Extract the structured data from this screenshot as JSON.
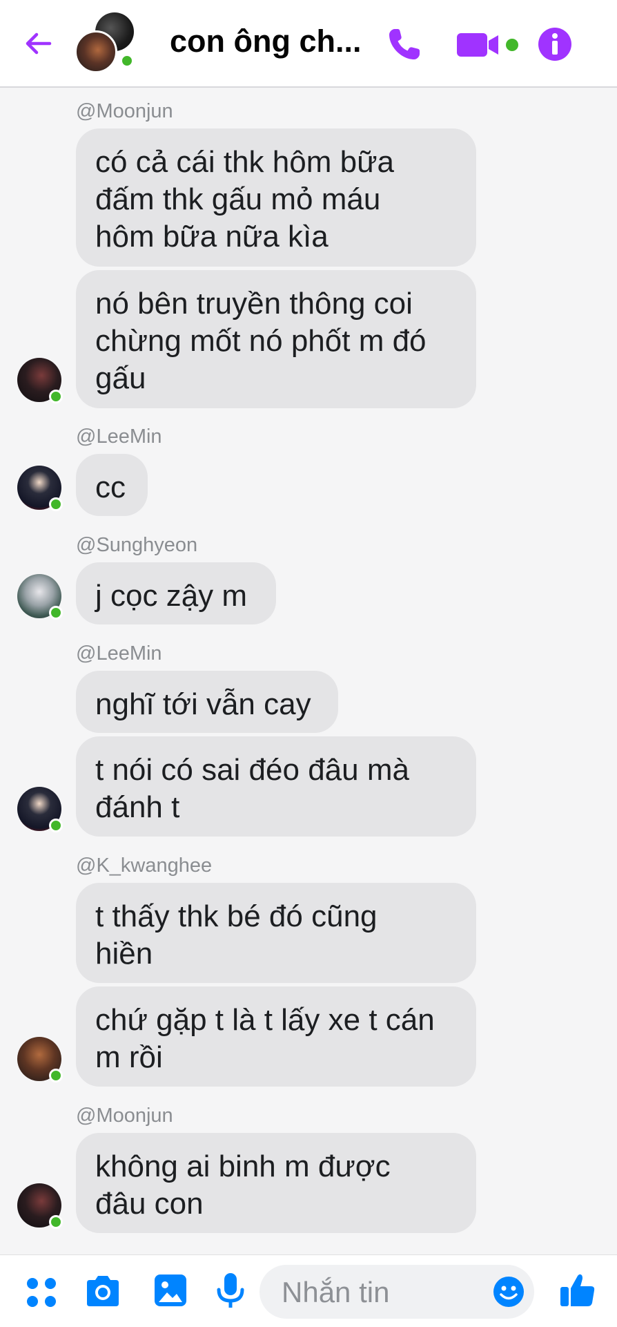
{
  "header": {
    "title": "con ông ch...",
    "accent_color": "#a033ff",
    "icons": [
      "back-arrow-icon",
      "phone-icon",
      "video-camera-icon",
      "info-icon"
    ]
  },
  "messages": [
    {
      "sender": "@Moonjun",
      "bubbles": [
        "có cả cái thk hôm bữa\nđấm thk gấu mỏ máu\nhôm bữa nữa kìa",
        "nó bên truyền thông coi\nchừng mốt nó phốt m đó\ngấu"
      ]
    },
    {
      "sender": "@LeeMin",
      "bubbles": [
        "cc"
      ]
    },
    {
      "sender": "@Sunghyeon",
      "bubbles": [
        "j cọc zậy m"
      ]
    },
    {
      "sender": "@LeeMin",
      "bubbles": [
        "nghĩ tới vẫn cay",
        "t nói có sai đéo đâu mà\nđánh t"
      ]
    },
    {
      "sender": "@K_kwanghee",
      "bubbles": [
        "t thấy thk bé đó cũng\nhiền",
        "chứ gặp t là t lấy xe t cán\nm rồi"
      ]
    },
    {
      "sender": "@Moonjun",
      "bubbles": [
        "không ai binh m được\nđâu con"
      ]
    }
  ],
  "composer": {
    "placeholder": "Nhắn tin",
    "icons": [
      "apps-grid-icon",
      "camera-icon",
      "gallery-icon",
      "microphone-icon",
      "emoji-icon",
      "thumbs-up-icon"
    ],
    "accent_color": "#0084ff"
  }
}
